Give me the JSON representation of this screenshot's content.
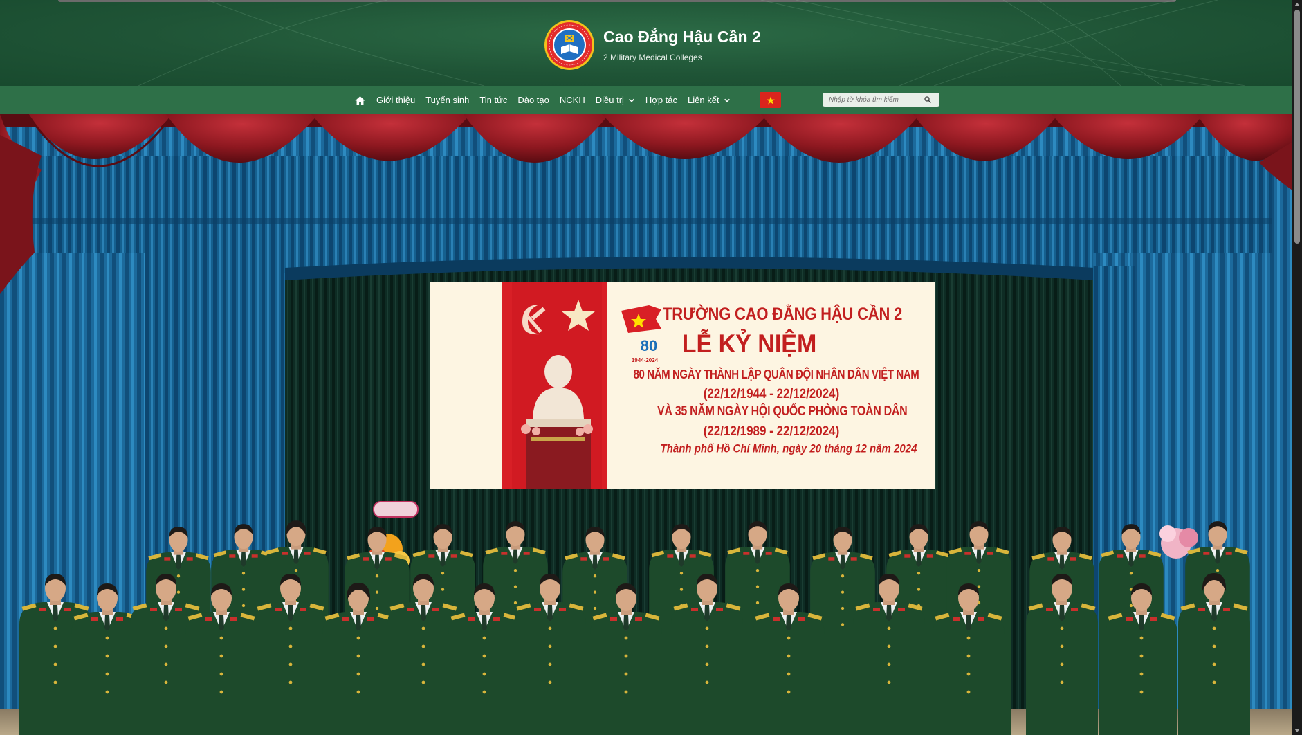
{
  "brand": {
    "title": "Cao Đẳng Hậu Cần 2",
    "subtitle": "2 Military Medical Colleges",
    "logo_icon": "college-emblem-icon"
  },
  "nav": {
    "home_icon": "home-icon",
    "items": [
      {
        "label": "Giới thiệu",
        "dropdown": false
      },
      {
        "label": "Tuyển sinh",
        "dropdown": false
      },
      {
        "label": "Tin tức",
        "dropdown": false
      },
      {
        "label": "Đào tạo",
        "dropdown": false
      },
      {
        "label": "NCKH",
        "dropdown": false
      },
      {
        "label": "Điều trị",
        "dropdown": true
      },
      {
        "label": "Hợp tác",
        "dropdown": false
      },
      {
        "label": "Liên kết",
        "dropdown": true
      }
    ],
    "language_icon": "vietnam-flag-icon"
  },
  "search": {
    "placeholder": "Nhập từ khóa tìm kiếm",
    "value": "",
    "icon": "search-icon"
  },
  "hero": {
    "banner": {
      "school": "TRƯỜNG CAO ĐẲNG HẬU CẦN 2",
      "event": "LỄ KỶ NIỆM",
      "line1": "80 NĂM NGÀY THÀNH LẬP QUÂN ĐỘI NHÂN DÂN VIỆT NAM",
      "line2": "(22/12/1944 - 22/12/2024)",
      "line3": "VÀ 35 NĂM NGÀY HỘI QUỐC PHÒNG TOÀN DÂN",
      "line4": "(22/12/1989 - 22/12/2024)",
      "line5": "Thành phố Hồ Chí Minh, ngày 20 tháng 12 năm 2024",
      "badge_number": "80",
      "badge_years": "1944-2024"
    }
  },
  "colors": {
    "header_green": "#1f5436",
    "nav_green": "#2e7048",
    "banner_red": "#c21f1f",
    "uniform_green": "#1d4a2b",
    "curtain_blue": "#1f6c9e",
    "curtain_red": "#8e1820"
  }
}
